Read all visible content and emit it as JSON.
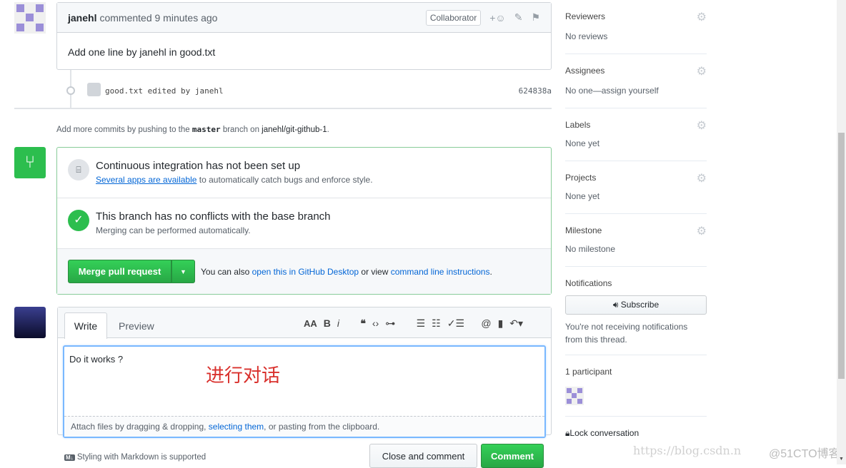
{
  "comment": {
    "author": "janehl",
    "action": "commented 9 minutes ago",
    "badge": "Collaborator",
    "body": "Add one line by janehl in good.txt"
  },
  "commit": {
    "message": "good.txt edited by janehl",
    "sha": "624838a"
  },
  "push_hint": {
    "prefix": "Add more commits by pushing to the",
    "branch": "master",
    "middle": "branch on",
    "repo": "janehl/git-github-1",
    "suffix": "."
  },
  "merge": {
    "ci_title": "Continuous integration has not been set up",
    "ci_link": "Several apps are available",
    "ci_rest": "to automatically catch bugs and enforce style.",
    "conflict_title": "This branch has no conflicts with the base branch",
    "conflict_sub": "Merging can be performed automatically.",
    "merge_button": "Merge pull request",
    "also_prefix": "You can also",
    "desktop_link": "open this in GitHub Desktop",
    "or_view": "or view",
    "cli_link": "command line instructions",
    "period": "."
  },
  "editor": {
    "tabs": [
      "Write",
      "Preview"
    ],
    "text": "Do it works ?",
    "annotation": "进行对话",
    "attach_prefix": "Attach files by dragging & dropping,",
    "attach_link": "selecting them",
    "attach_suffix": ", or pasting from the clipboard.",
    "markdown_hint": "Styling with Markdown is supported",
    "close_button": "Close and comment",
    "comment_button": "Comment",
    "toolbar_icons": [
      "text-size-icon",
      "bold-icon",
      "italic-icon",
      "quote-icon",
      "code-icon",
      "link-icon",
      "unordered-list-icon",
      "ordered-list-icon",
      "task-list-icon",
      "mention-icon",
      "bookmark-icon",
      "reply-icon"
    ]
  },
  "sidebar": {
    "sections": [
      {
        "title": "Reviewers",
        "value": "No reviews"
      },
      {
        "title": "Assignees",
        "value": "No one—assign yourself"
      },
      {
        "title": "Labels",
        "value": "None yet"
      },
      {
        "title": "Projects",
        "value": "None yet"
      },
      {
        "title": "Milestone",
        "value": "No milestone"
      }
    ],
    "notifications_title": "Notifications",
    "subscribe": "Subscribe",
    "notif_text": "You're not receiving notifications from this thread.",
    "participants": "1 participant",
    "lock": "Lock conversation"
  },
  "watermark": {
    "csdn": "https://blog.csdn.n",
    "cto": "@51CTO博客"
  },
  "colors": {
    "green": "#28a745",
    "link": "#0366d6",
    "annotation": "#d9302c"
  }
}
